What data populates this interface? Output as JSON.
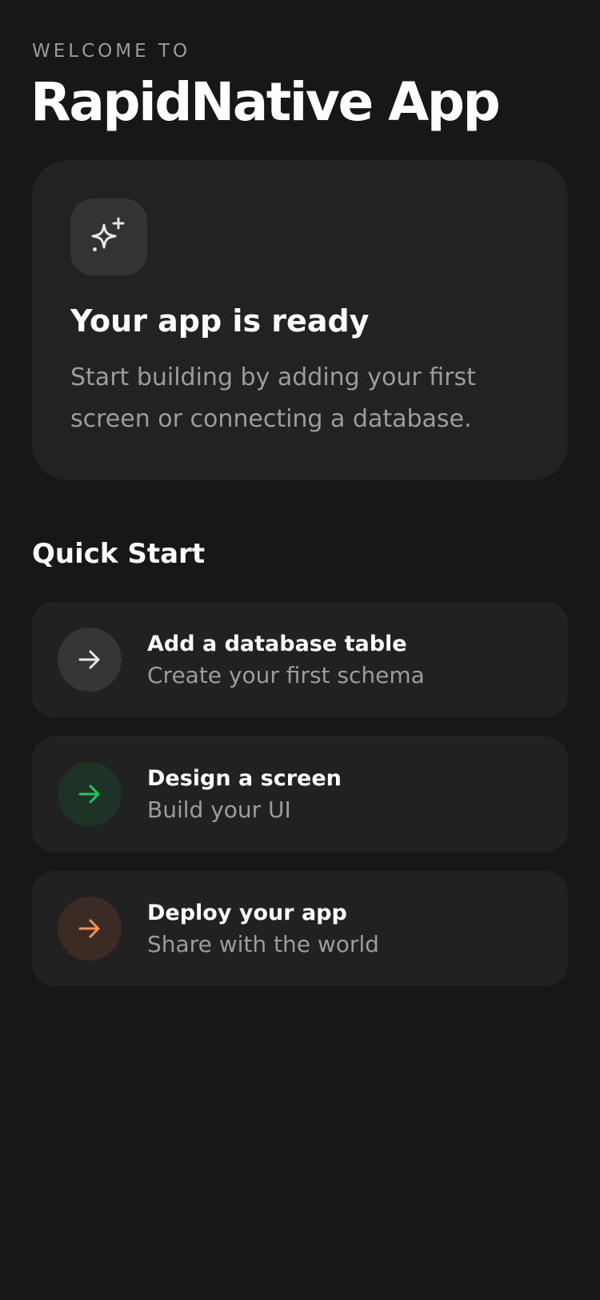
{
  "header": {
    "eyebrow": "WELCOME TO",
    "title": "RapidNative App"
  },
  "hero": {
    "icon": "sparkles-icon",
    "title": "Your app is ready",
    "description": "Start building by adding your first screen or connecting a database."
  },
  "quick_start": {
    "heading": "Quick Start",
    "items": [
      {
        "title": "Add a database table",
        "subtitle": "Create your first schema",
        "icon": "arrow-right-icon",
        "icon_color": "#e8e8e8",
        "icon_bg": "#363636"
      },
      {
        "title": "Design a screen",
        "subtitle": "Build your UI",
        "icon": "arrow-right-icon",
        "icon_color": "#22c55e",
        "icon_bg": "#1e3325"
      },
      {
        "title": "Deploy your app",
        "subtitle": "Share with the world",
        "icon": "arrow-right-icon",
        "icon_color": "#f59153",
        "icon_bg": "#3a2c25"
      }
    ]
  },
  "colors": {
    "background": "#171717",
    "card": "#222222",
    "text_primary": "#ffffff",
    "text_secondary": "#9c9c9c"
  }
}
